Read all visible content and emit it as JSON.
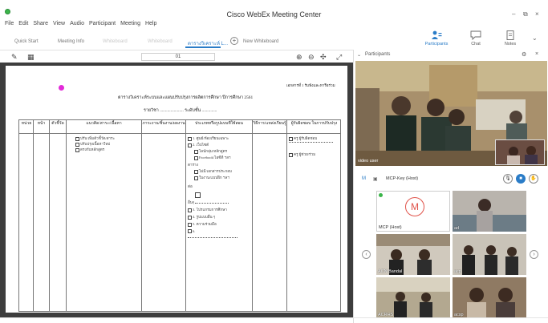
{
  "window": {
    "title": "Cisco WebEx Meeting Center",
    "minimize": "–",
    "maximize": "⧉",
    "close": "×"
  },
  "menu": [
    "File",
    "Edit",
    "Share",
    "View",
    "Audio",
    "Participant",
    "Meeting",
    "Help"
  ],
  "tabs": {
    "quick_start": "Quick Start",
    "meeting_info": "Meeting Info",
    "whiteboard_1": "Whiteboard",
    "whiteboard_2": "Whiteboard",
    "active_doc": "ตารางวิเคราะห์ L...",
    "new_whiteboard": "New Whiteboard"
  },
  "ribbon": {
    "participants": "Participants",
    "chat": "Chat",
    "notes": "Notes"
  },
  "doc_toolbar": {
    "page": "01"
  },
  "document": {
    "corner_note": "เอกสารที่ 1 รับฟังและหารือร่วม",
    "title_line_1": "ตารางวิเคราะห์ระบบและแผนปรับปรุงการผลิตการศึกษา ปีการศึกษา 2561",
    "title_line_2": "รายวิชา ...................... ระดับชั้น ..............",
    "headers": {
      "col1": "หน่วย",
      "col2": "หน้า",
      "col3": "ตัวชี้วัด",
      "col4": "แนวคิด/สาระ/เนื้อหา",
      "col5": "ภาระงาน/ชิ้นงาน/ผลงาน",
      "col6": "ประเภทหรือรูปแบบที่ใช้สอน",
      "col7": "วิธีการ/แหล่งเรียนรู้",
      "col8": "ผู้รับผิดชอบ ในการปรับปรุง"
    },
    "col4_items": [
      "ปรับ/เพิ่มตัวชี้วัด/สาระ",
      "ปรับปรุงเนื้อหาใหม่",
      "ตรงกับหลักสูตร"
    ],
    "col6_items": [
      "1. ศูนย์/ห้องเรียนเฉพาะ",
      "2. เว็บไซต์",
      "ไลน์กลุ่ม/หลักสูตร",
      "Facebook/ไอซีที ฯลฯ",
      "ตาราง",
      "ไม่มี/เอกสารประกอบ",
      "ใบงาน/แบบฝึก ฯลฯ",
      "ต่อ",
      "อื่นๆ",
      "3. โปรแกรมการศึกษา",
      "4. รูปแบบอื่น ๆ",
      "5. ความร่วมมือ",
      "6."
    ],
    "col8_items": [
      "ครู ผู้รับผิดชอบ",
      "ครู ผู้ช่วย/ร่วม"
    ]
  },
  "participants_panel": {
    "title": "Participants",
    "video_label": "video user",
    "presenter_name": "MCP-Key (Host)"
  },
  "thumbnails": [
    {
      "name": "MCP (Host)",
      "avatar": "M"
    },
    {
      "name": "ad"
    },
    {
      "name": "ACN Bandal"
    },
    {
      "name": "acp"
    },
    {
      "name": "ACRHS"
    },
    {
      "name": "acsp"
    }
  ],
  "colors": {
    "accent": "#2a7cc7",
    "pointer": "#e22ad8",
    "logo": "#3bb54a"
  }
}
